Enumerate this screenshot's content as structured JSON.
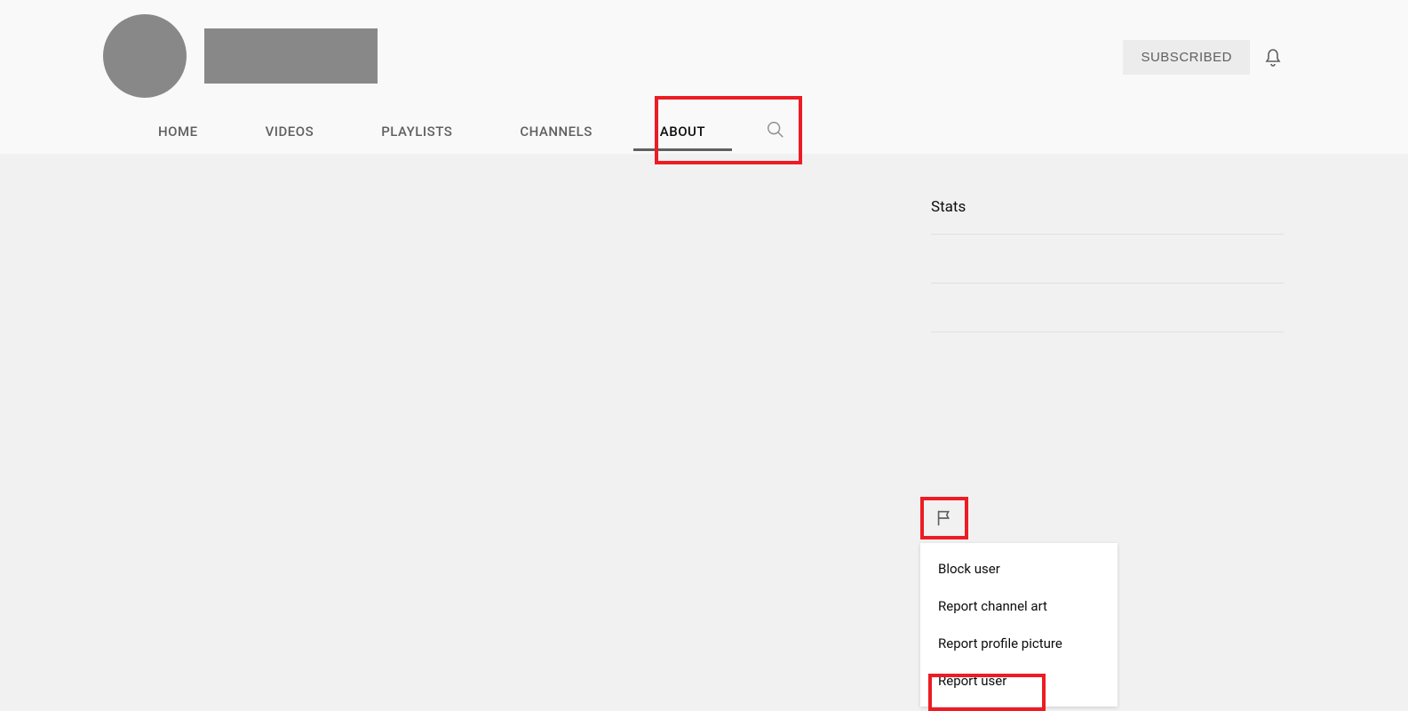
{
  "header": {
    "subscribed_label": "SUBSCRIBED"
  },
  "tabs": {
    "home": "HOME",
    "videos": "VIDEOS",
    "playlists": "PLAYLISTS",
    "channels": "CHANNELS",
    "about": "ABOUT"
  },
  "stats": {
    "title": "Stats"
  },
  "menu": {
    "block_user": "Block user",
    "report_channel_art": "Report channel art",
    "report_profile_picture": "Report profile picture",
    "report_user": "Report user"
  }
}
